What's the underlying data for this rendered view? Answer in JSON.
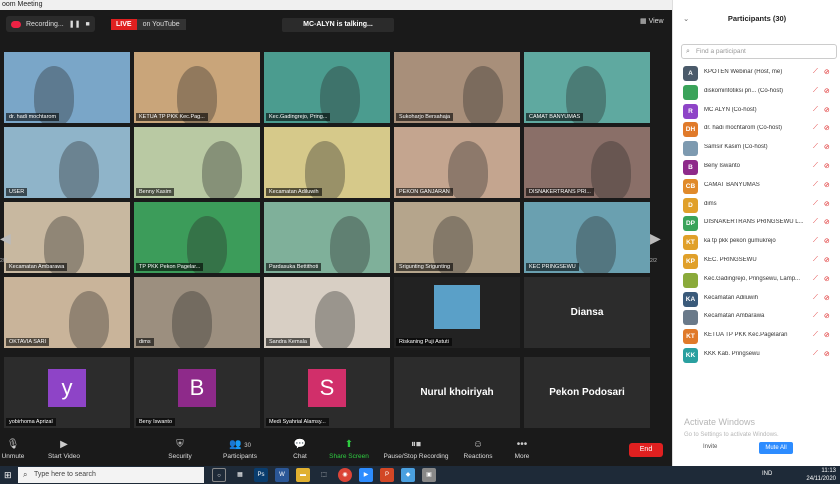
{
  "window": {
    "title": "oom Meeting"
  },
  "topbar": {
    "recording_label": "Recording...",
    "pause_icon": "pause-icon",
    "stop_icon": "stop-icon",
    "live_label": "LIVE",
    "youtube_label": "on YouTube",
    "talking_label": "MC-ALYN is talking...",
    "view_label": "View"
  },
  "tiles": [
    {
      "label": "dr. hadi mochtarom",
      "bg": "#7aa6c8"
    },
    {
      "label": "KETUA TP PKK Kec.Pag...",
      "bg": "#c9a57a"
    },
    {
      "label": "Kec.Gadingrejo, Pring...",
      "bg": "#4b9c8f"
    },
    {
      "label": "Sukoharjo Bersahaja",
      "bg": "#a88f7a"
    },
    {
      "label": "CAMAT BANYUMAS",
      "bg": "#5fa9a0"
    },
    {
      "label": "USER",
      "bg": "#8fb4c9"
    },
    {
      "label": "Benny Kasim",
      "bg": "#b9c9a3"
    },
    {
      "label": "Kecamatan Adiluwih",
      "bg": "#d6c98a"
    },
    {
      "label": "PEKON GANJARAN",
      "bg": "#c4a58f"
    },
    {
      "label": "DISNAKERTRANS PRI...",
      "bg": "#8a6f68"
    },
    {
      "label": "Kecamatan Ambarawa",
      "bg": "#c8b8a0"
    },
    {
      "label": "TP PKK Pekon Pagelar...",
      "bg": "#3c9c5a"
    },
    {
      "label": "Pardasuka Bettithoti",
      "bg": "#7fb09a"
    },
    {
      "label": "Srigunting Srigunting",
      "bg": "#b5a58c"
    },
    {
      "label": "KEC PRINGSEWU",
      "bg": "#6aa0b0"
    },
    {
      "label": "OKTAVIA SARI",
      "bg": "#c9b49a"
    },
    {
      "label": "dims",
      "bg": "#9c8f7f"
    },
    {
      "label": "Sandra Kemala",
      "bg": "#d8cfc4"
    },
    {
      "label": "Riskaning Puji Astuti",
      "bg": "#222222"
    },
    {
      "label": "",
      "bigname": "Diansa",
      "bg": "#2c2c2c"
    },
    {
      "label": "yobirhoma Aprizal",
      "avatar": "y",
      "avatar_bg": "#8e44c7",
      "bg": "#2c2c2c"
    },
    {
      "label": "Beny Iswanto",
      "avatar": "B",
      "avatar_bg": "#8e2a8a",
      "bg": "#2c2c2c"
    },
    {
      "label": "Medi Syahrial Alamsy...",
      "avatar": "S",
      "avatar_bg": "#d12f6a",
      "bg": "#2c2c2c"
    },
    {
      "label": "",
      "bigname": "Nurul khoiriyah",
      "bg": "#2c2c2c"
    },
    {
      "label": "",
      "bigname": "Pekon Podosari",
      "bg": "#2c2c2c"
    }
  ],
  "pager": {
    "left": "2/2",
    "right": "2/2"
  },
  "toolbar": {
    "unmute": "Unmute",
    "start_video": "Start Video",
    "security": "Security",
    "participants": "Participants",
    "participants_count": "30",
    "chat": "Chat",
    "share_screen": "Share Screen",
    "pause_recording": "Pause/Stop Recording",
    "reactions": "Reactions",
    "more": "More",
    "end": "End"
  },
  "panel": {
    "title": "Participants (30)",
    "search_placeholder": "Find a participant",
    "invite": "Invite",
    "mute_all": "Mute All",
    "watermark": "Activate Windows",
    "watermark_sub": "Go to Settings to activate Windows.",
    "participants": [
      {
        "initial": "A",
        "color": "#4a5a6a",
        "name": "KPOTEN Webinar (Host, me)"
      },
      {
        "initial": "",
        "color": "#3aa35a",
        "name": "diskominfotiksi pri... (Co-host)"
      },
      {
        "initial": "R",
        "color": "#8e44c7",
        "name": "MC ALYN (Co-host)"
      },
      {
        "initial": "DH",
        "color": "#e07a2a",
        "name": "dr. hadi mochtarom (Co-host)"
      },
      {
        "initial": "",
        "color": "#7d9ab0",
        "name": "Samsir Kasim (Co-host)"
      },
      {
        "initial": "B",
        "color": "#8e2a8a",
        "name": "Beny Iswanto"
      },
      {
        "initial": "CB",
        "color": "#e08a2a",
        "name": "CAMAT BANYUMAS"
      },
      {
        "initial": "D",
        "color": "#e0a02a",
        "name": "dims"
      },
      {
        "initial": "DP",
        "color": "#3aa35a",
        "name": "DISNAKERTRANS PRINGSEWU L..."
      },
      {
        "initial": "KT",
        "color": "#e0a02a",
        "name": "ka tp pkk pekon gumukrejo"
      },
      {
        "initial": "KP",
        "color": "#e0a02a",
        "name": "KEC. PRINGSEWU"
      },
      {
        "initial": "",
        "color": "#8aaa3a",
        "name": "Kec.Gadingrejo, Pringsewu, Lamp..."
      },
      {
        "initial": "KA",
        "color": "#3a5a7a",
        "name": "Kecamatan Adiluwih"
      },
      {
        "initial": "",
        "color": "#6a7a8a",
        "name": "Kecamatan Ambarawa"
      },
      {
        "initial": "KT",
        "color": "#e07a2a",
        "name": "KETUA TP PKK Kec.Pagelaran"
      },
      {
        "initial": "KK",
        "color": "#2aa0a0",
        "name": "KKK Kab. Pringsewu"
      }
    ]
  },
  "taskbar": {
    "search_placeholder": "Type here to search",
    "time": "11:13",
    "date": "24/11/2020",
    "lang": "IND"
  }
}
